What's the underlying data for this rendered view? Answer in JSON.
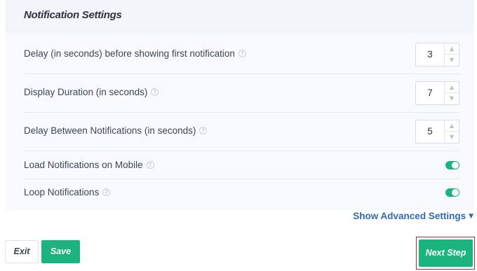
{
  "panel": {
    "title": "Notification Settings"
  },
  "settings": [
    {
      "label": "Delay (in seconds) before showing first notification",
      "type": "stepper",
      "value": "3"
    },
    {
      "label": "Display Duration (in seconds)",
      "type": "stepper",
      "value": "7"
    },
    {
      "label": "Delay Between Notifications (in seconds)",
      "type": "stepper",
      "value": "5"
    },
    {
      "label": "Load Notifications on Mobile",
      "type": "toggle",
      "on": true
    },
    {
      "label": "Loop Notifications",
      "type": "toggle",
      "on": true
    }
  ],
  "icons": {
    "help": "?",
    "stepper_up": "▲",
    "stepper_down": "▼",
    "caret": "▼"
  },
  "advanced_link": "Show Advanced Settings",
  "buttons": {
    "exit": "Exit",
    "save": "Save",
    "next": "Next Step"
  },
  "colors": {
    "accent": "#1bb47e",
    "link": "#2f6bb3",
    "highlight_frame": "#b03036"
  }
}
